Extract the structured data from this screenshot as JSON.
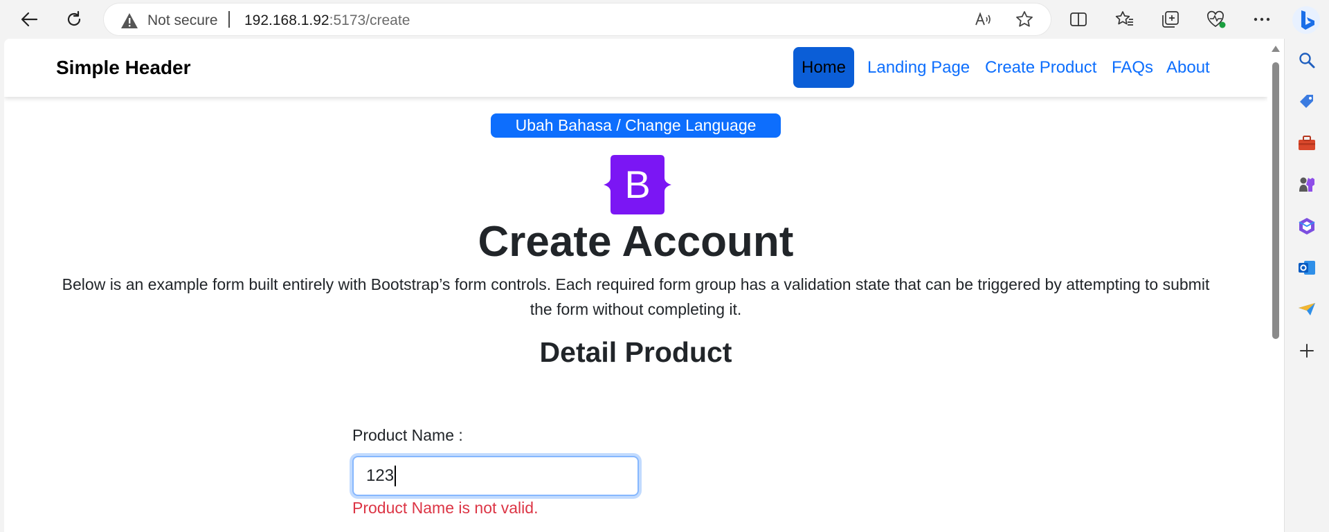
{
  "browser": {
    "security_label": "Not secure",
    "url_host": "192.168.1.92",
    "url_path": ":5173/create"
  },
  "header": {
    "brand": "Simple Header",
    "nav": [
      {
        "label": "Home",
        "active": true
      },
      {
        "label": "Landing Page",
        "active": false
      },
      {
        "label": "Create Product",
        "active": false
      },
      {
        "label": "FAQs",
        "active": false
      },
      {
        "label": "About",
        "active": false
      }
    ]
  },
  "main": {
    "language_button": "Ubah Bahasa / Change Language",
    "logo_letter": "B",
    "title": "Create Account",
    "lead": "Below is an example form built entirely with Bootstrap’s form controls. Each required form group has a validation state that can be triggered by attempting to submit the form without completing it.",
    "section_title": "Detail Product",
    "form": {
      "product_name_label": "Product Name :",
      "product_name_value": "123",
      "product_name_error": "Product Name is not valid."
    }
  },
  "colors": {
    "primary": "#0d6efd",
    "active_nav": "#0b5ed7",
    "error": "#dc3545",
    "logo": "#7b16f4"
  }
}
